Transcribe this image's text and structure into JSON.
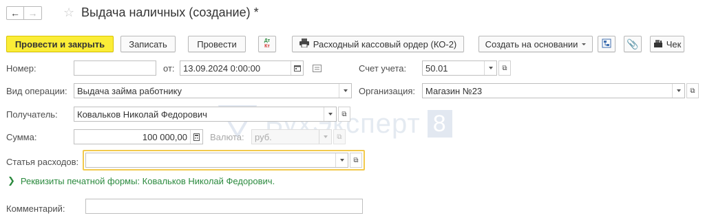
{
  "title": "Выдача наличных (создание) *",
  "toolbar": {
    "post_close": "Провести и закрыть",
    "save": "Записать",
    "post": "Провести",
    "dt_icon_top": "Дт",
    "dt_icon_bottom": "Кт",
    "print_order": "Расходный кассовый ордер (КО-2)",
    "create_based": "Создать на основании",
    "check": "Чек"
  },
  "form": {
    "number_label": "Номер:",
    "number_value": "",
    "from_label": "от:",
    "date_value": "13.09.2024  0:00:00",
    "account_label": "Счет учета:",
    "account_value": "50.01",
    "operation_label": "Вид операции:",
    "operation_value": "Выдача займа работнику",
    "org_label": "Организация:",
    "org_value": "Магазин №23",
    "recipient_label": "Получатель:",
    "recipient_value": "Ковальков Николай Федорович",
    "amount_label": "Сумма:",
    "amount_value": "100 000,00",
    "currency_label": "Валюта:",
    "currency_value": "руб.",
    "expense_label": "Статья расходов:",
    "expense_value": "",
    "print_details": "Реквизиты печатной формы: Ковальков Николай Федорович.",
    "comment_label": "Комментарий:",
    "comment_value": ""
  },
  "watermark": {
    "text": "БухЭксперт",
    "digit": "8"
  },
  "colors": {
    "primary_button": "#fbed37",
    "focus_border": "#f2c94c",
    "link_green": "#2b8a3e"
  }
}
